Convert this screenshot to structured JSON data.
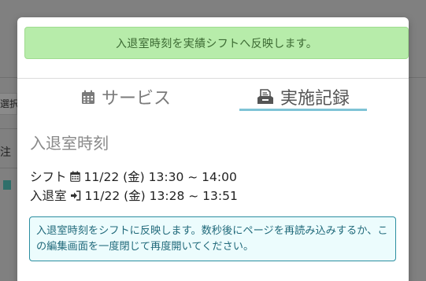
{
  "background": {
    "left_texts": [
      "選択",
      "注"
    ]
  },
  "modal": {
    "success_message": "入退室時刻を実績シフトへ反映します。",
    "tabs": [
      {
        "label": "サービス",
        "icon": "calendar-icon",
        "active": false
      },
      {
        "label": "実施記録",
        "icon": "document-icon",
        "active": true
      }
    ],
    "section_title": "入退室時刻",
    "shift_label": "シフト",
    "shift_value": "11/22 (金) 13:30 ~ 14:00",
    "room_label": "入退室",
    "room_value": "11/22 (金) 13:28 ~ 13:51",
    "info_message": "入退室時刻をシフトに反映します。数秒後にページを再読み込みするか、この編集画面を一度閉じて再度開いてください。"
  },
  "colors": {
    "success_bg": "#b7ecaa",
    "info_border": "#2b8ea0",
    "tab_underline": "#7fc4d6",
    "overlay": "#808080"
  }
}
